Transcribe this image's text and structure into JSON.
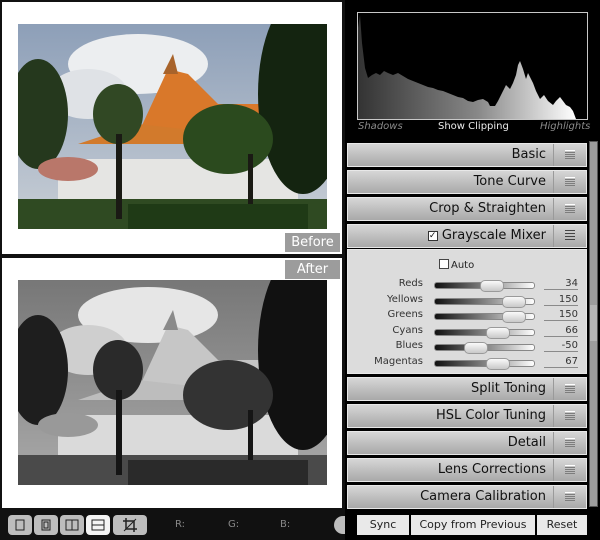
{
  "preview": {
    "before_label": "Before",
    "after_label": "After",
    "photo_subject": "Thai temple with orange-tiled roofs, trees and white wall",
    "before_mode": "color",
    "after_mode": "grayscale"
  },
  "toolbar": {
    "view_buttons": [
      {
        "name": "loupe-view",
        "icon": "single-frame-icon",
        "active": false
      },
      {
        "name": "before-after-left-right-split",
        "icon": "split-frame-icon",
        "active": false
      },
      {
        "name": "before-after-left-right",
        "icon": "side-by-side-icon",
        "active": false
      },
      {
        "name": "before-after-top-bottom",
        "icon": "top-bottom-icon",
        "active": true
      },
      {
        "name": "crop-tool",
        "icon": "crop-icon",
        "active": false
      }
    ],
    "r_label": "R:",
    "g_label": "G:",
    "b_label": "B:"
  },
  "histogram": {
    "shadows_label": "Shadows",
    "clipping_label": "Show Clipping",
    "highlights_label": "Highlights"
  },
  "sections": [
    {
      "title": "Basic",
      "expanded": false
    },
    {
      "title": "Tone Curve",
      "expanded": false
    },
    {
      "title": "Crop & Straighten",
      "expanded": false
    },
    {
      "title": "Grayscale Mixer",
      "expanded": true,
      "enabled": true
    },
    {
      "title": "Split Toning",
      "expanded": false
    },
    {
      "title": "HSL Color Tuning",
      "expanded": false
    },
    {
      "title": "Detail",
      "expanded": false
    },
    {
      "title": "Lens Corrections",
      "expanded": false
    },
    {
      "title": "Camera Calibration",
      "expanded": false
    }
  ],
  "grayscale_mixer": {
    "auto_label": "Auto",
    "auto_checked": false,
    "range": [
      -200,
      200
    ],
    "sliders": [
      {
        "label": "Reds",
        "value": "34",
        "num": 34
      },
      {
        "label": "Yellows",
        "value": "150",
        "num": 150
      },
      {
        "label": "Greens",
        "value": "150",
        "num": 150
      },
      {
        "label": "Cyans",
        "value": "66",
        "num": 66
      },
      {
        "label": "Blues",
        "value": "-50",
        "num": -50
      },
      {
        "label": "Magentas",
        "value": "67",
        "num": 67
      }
    ]
  },
  "buttons": {
    "sync": "Sync",
    "copy_from_previous": "Copy from Previous",
    "reset": "Reset"
  }
}
